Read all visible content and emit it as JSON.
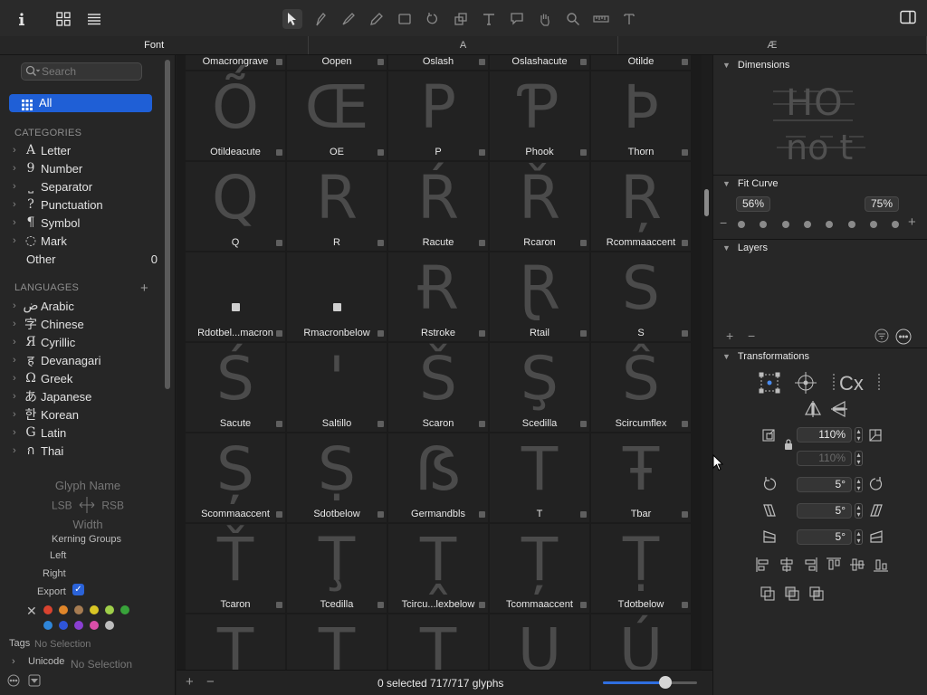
{
  "toolbar": {
    "info_icon": "info-icon",
    "tools": [
      "select-tool-icon",
      "pen-icon",
      "draw-icon",
      "pencil-icon",
      "rectangle-icon",
      "rotate-icon",
      "scale-icon",
      "text-icon",
      "annotation-icon",
      "hand-icon",
      "zoom-icon",
      "measure-icon",
      "type-icon"
    ]
  },
  "tabs": [
    "Font",
    "A",
    "Æ"
  ],
  "sidebar": {
    "search_placeholder": "Search",
    "all_label": "All",
    "categories_header": "CATEGORIES",
    "categories": [
      {
        "glyph": "A",
        "label": "Letter"
      },
      {
        "glyph": "9",
        "label": "Number"
      },
      {
        "glyph": "⎵",
        "label": "Separator"
      },
      {
        "glyph": "?",
        "label": "Punctuation"
      },
      {
        "glyph": "¶",
        "label": "Symbol"
      },
      {
        "glyph": "◌",
        "label": "Mark"
      }
    ],
    "other_label": "Other",
    "other_count": "0",
    "languages_header": "LANGUAGES",
    "languages": [
      {
        "glyph": "ض",
        "label": "Arabic"
      },
      {
        "glyph": "字",
        "label": "Chinese"
      },
      {
        "glyph": "Я",
        "label": "Cyrillic"
      },
      {
        "glyph": "ह",
        "label": "Devanagari"
      },
      {
        "glyph": "Ω",
        "label": "Greek"
      },
      {
        "glyph": "あ",
        "label": "Japanese"
      },
      {
        "glyph": "한",
        "label": "Korean"
      },
      {
        "glyph": "G",
        "label": "Latin"
      },
      {
        "glyph": "ก",
        "label": "Thai"
      }
    ],
    "info": {
      "glyph_name": "Glyph Name",
      "lsb": "LSB",
      "rsb": "RSB",
      "width": "Width",
      "kerning_groups": "Kerning Groups",
      "left": "Left",
      "right": "Right",
      "export": "Export",
      "tags": "Tags",
      "tags_value": "No Selection",
      "unicode": "Unicode",
      "unicode_value": "No Selection"
    },
    "colors": [
      "#d9432f",
      "#e0862a",
      "#a67c52",
      "#d9c625",
      "#9fcf4a",
      "#38a33a",
      "#2f86d9",
      "#2f55d9",
      "#8a3fd1",
      "#d94fa8",
      "#bdbdbd"
    ]
  },
  "grid": {
    "rows": [
      [
        {
          "name": "Omacrongrave",
          "glyph": ""
        },
        {
          "name": "Oopen",
          "glyph": ""
        },
        {
          "name": "Oslash",
          "glyph": ""
        },
        {
          "name": "Oslashacute",
          "glyph": ""
        },
        {
          "name": "Otilde",
          "glyph": ""
        }
      ],
      [
        {
          "name": "Otildeacute",
          "glyph": "Ṍ"
        },
        {
          "name": "OE",
          "glyph": "Œ"
        },
        {
          "name": "P",
          "glyph": "P"
        },
        {
          "name": "Phook",
          "glyph": "Ƥ"
        },
        {
          "name": "Thorn",
          "glyph": "Þ"
        }
      ],
      [
        {
          "name": "Q",
          "glyph": "Q"
        },
        {
          "name": "R",
          "glyph": "R"
        },
        {
          "name": "Racute",
          "glyph": "Ŕ"
        },
        {
          "name": "Rcaron",
          "glyph": "Ř"
        },
        {
          "name": "Rcommaaccent",
          "glyph": "Ŗ"
        }
      ],
      [
        {
          "name": "Rdotbel...macron",
          "glyph": ""
        },
        {
          "name": "Rmacronbelow",
          "glyph": ""
        },
        {
          "name": "Rstroke",
          "glyph": "Ɍ"
        },
        {
          "name": "Rtail",
          "glyph": "Ɽ"
        },
        {
          "name": "S",
          "glyph": "S"
        }
      ],
      [
        {
          "name": "Sacute",
          "glyph": "Ś"
        },
        {
          "name": "Saltillo",
          "glyph": "ꞌ"
        },
        {
          "name": "Scaron",
          "glyph": "Š"
        },
        {
          "name": "Scedilla",
          "glyph": "Ş"
        },
        {
          "name": "Scircumflex",
          "glyph": "Ŝ"
        }
      ],
      [
        {
          "name": "Scommaaccent",
          "glyph": "Ș"
        },
        {
          "name": "Sdotbelow",
          "glyph": "Ṣ"
        },
        {
          "name": "Germandbls",
          "glyph": "ẞ"
        },
        {
          "name": "T",
          "glyph": "T"
        },
        {
          "name": "Tbar",
          "glyph": "Ŧ"
        }
      ],
      [
        {
          "name": "Tcaron",
          "glyph": "Ť"
        },
        {
          "name": "Tcedilla",
          "glyph": "Ţ"
        },
        {
          "name": "Tcircu...lexbelow",
          "glyph": "Ṱ"
        },
        {
          "name": "Tcommaaccent",
          "glyph": "Ț"
        },
        {
          "name": "Tdotbelow",
          "glyph": "Ṭ"
        }
      ],
      [
        {
          "name": "",
          "glyph": "T"
        },
        {
          "name": "",
          "glyph": "T"
        },
        {
          "name": "",
          "glyph": "T"
        },
        {
          "name": "",
          "glyph": "U"
        },
        {
          "name": "",
          "glyph": "Ú"
        }
      ]
    ]
  },
  "status": {
    "text": "0 selected 717/717 glyphs",
    "zoom_fraction": 0.66
  },
  "inspector": {
    "dimensions_label": "Dimensions",
    "fit_curve_label": "Fit Curve",
    "fit_min": "56%",
    "fit_max": "75%",
    "layers_label": "Layers",
    "transformations_label": "Transformations",
    "scale_x": "110%",
    "scale_y": "110%",
    "rotate": "5°",
    "slant": "5°",
    "skew": "5°",
    "preview_top": "HO",
    "preview_bottom": "no t"
  }
}
